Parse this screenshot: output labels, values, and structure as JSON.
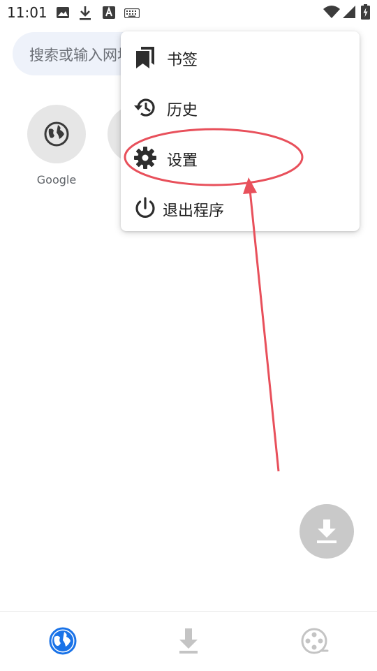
{
  "status_bar": {
    "time": "11:01",
    "icons": [
      "image-icon",
      "download-icon",
      "font-icon",
      "keyboard-icon",
      "wifi-icon",
      "signal-icon",
      "battery-icon"
    ]
  },
  "search": {
    "placeholder": "搜索或输入网址"
  },
  "shortcuts": [
    {
      "label": "Google",
      "icon": "globe-icon"
    },
    {
      "label": "",
      "icon": "globe-icon"
    }
  ],
  "menu": {
    "items": [
      {
        "label": "书签",
        "icon": "bookmark-icon"
      },
      {
        "label": "历史",
        "icon": "history-icon"
      },
      {
        "label": "设置",
        "icon": "gear-icon"
      },
      {
        "label": "退出程序",
        "icon": "power-icon"
      }
    ]
  },
  "annotation": {
    "color": "#e8505b",
    "target": "设置"
  },
  "fab": {
    "icon": "download-icon",
    "color": "#c9c9c9"
  },
  "bottom_nav": {
    "items": [
      {
        "icon": "globe-icon",
        "active": true
      },
      {
        "icon": "download-icon",
        "active": false
      },
      {
        "icon": "film-reel-icon",
        "active": false
      }
    ],
    "active_color": "#1a73e8",
    "inactive_color": "#c4c4c4"
  }
}
